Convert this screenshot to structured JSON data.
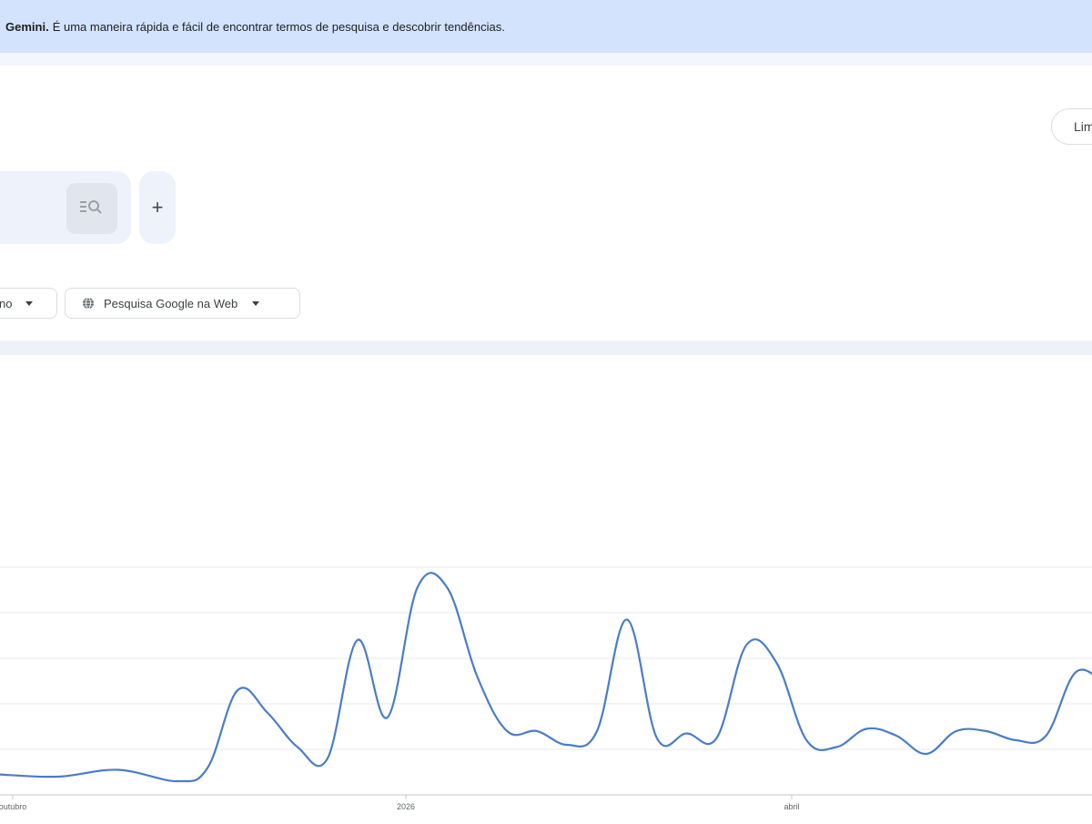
{
  "banner": {
    "bold": "Gemini.",
    "text": "É uma maneira rápida e fácil de encontrar termos de pesquisa e descobrir tendências."
  },
  "top_button_label": "Lim",
  "search": {
    "explore_icon": "explore-search-icon",
    "add_label": "+"
  },
  "filters": {
    "period_label": "no",
    "property_label": "Pesquisa Google na Web",
    "property_icon": "globe-icon"
  },
  "colors": {
    "banner_bg": "#d3e3fd",
    "series_line": "#4a7cc9",
    "grid": "#e8eaed"
  },
  "chart_data": {
    "type": "line",
    "x_tick_labels": [
      "outubro",
      "2026",
      "abril"
    ],
    "series": [
      {
        "values": [
          [
            0,
            9
          ],
          [
            2,
            8
          ],
          [
            4,
            11
          ],
          [
            6,
            6
          ],
          [
            7,
            12
          ],
          [
            8,
            46
          ],
          [
            9,
            36
          ],
          [
            10,
            21
          ],
          [
            11,
            16
          ],
          [
            12,
            68
          ],
          [
            13,
            34
          ],
          [
            14,
            91
          ],
          [
            15,
            91
          ],
          [
            16,
            52
          ],
          [
            17,
            28
          ],
          [
            18,
            28
          ],
          [
            19,
            22
          ],
          [
            20,
            28
          ],
          [
            21,
            77
          ],
          [
            22,
            25
          ],
          [
            23,
            27
          ],
          [
            24,
            25
          ],
          [
            25,
            66
          ],
          [
            26,
            58
          ],
          [
            27,
            24
          ],
          [
            28,
            21
          ],
          [
            29,
            29
          ],
          [
            30,
            26
          ],
          [
            31,
            18
          ],
          [
            32,
            28
          ],
          [
            33,
            28
          ],
          [
            34,
            24
          ],
          [
            35,
            26
          ],
          [
            36,
            54
          ],
          [
            37,
            48
          ]
        ]
      }
    ],
    "ylim": [
      0,
      100
    ],
    "grid": true,
    "legend": "none"
  }
}
